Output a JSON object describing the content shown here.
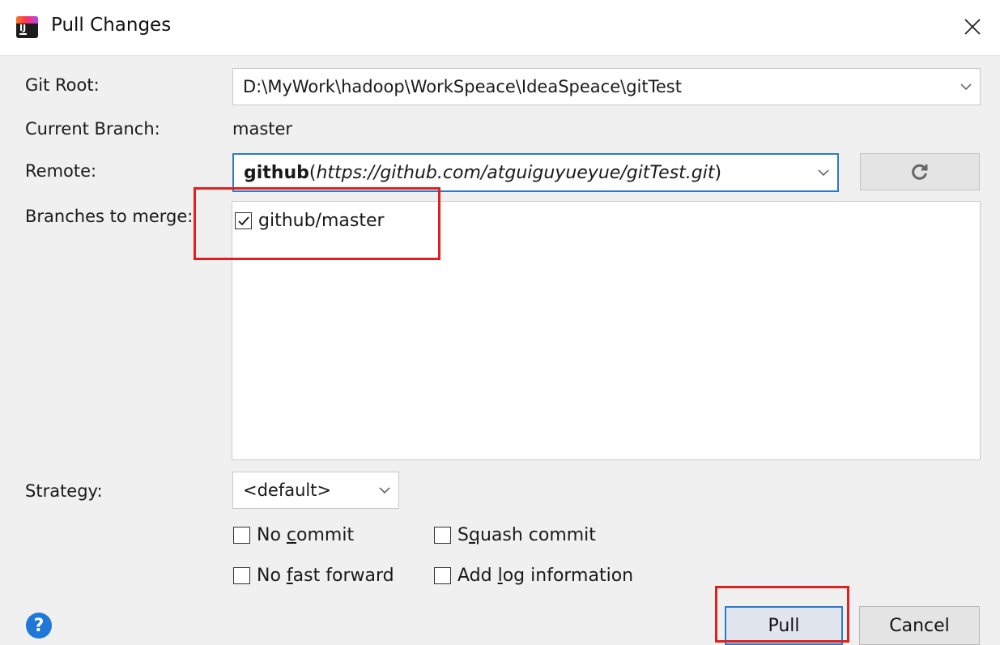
{
  "dialog": {
    "title": "Pull Changes"
  },
  "labels": {
    "git_root": "Git Root:",
    "current_branch": "Current Branch:",
    "remote": "Remote:",
    "branches": "Branches to merge:",
    "strategy": "Strategy:"
  },
  "git_root": {
    "value": "D:\\MyWork\\hadoop\\WorkSpeace\\IdeaSpeace\\gitTest"
  },
  "current_branch": {
    "value": "master"
  },
  "remote": {
    "name": "github",
    "open": "(",
    "url": "https://github.com/atguiguyueyue/gitTest.git",
    "close": ")"
  },
  "branches": [
    {
      "label": "github/master",
      "checked": true
    }
  ],
  "strategy": {
    "value": "<default>"
  },
  "options": {
    "no_commit": {
      "pre": "No ",
      "key": "c",
      "post": "ommit",
      "checked": false
    },
    "squash_commit": {
      "pre": "S",
      "key": "q",
      "post": "uash commit",
      "checked": false
    },
    "no_fast_forward": {
      "pre": "No ",
      "key": "f",
      "post": "ast forward",
      "checked": false
    },
    "add_log_information": {
      "pre": "Add ",
      "key": "l",
      "post": "og information",
      "checked": false
    }
  },
  "buttons": {
    "pull": "Pull",
    "cancel": "Cancel"
  },
  "icons": {
    "app": "intellij-idea-icon",
    "close": "close-icon",
    "refresh": "refresh-icon",
    "help": "help-icon",
    "dropdown": "chevron-down-icon"
  },
  "colors": {
    "focus_border": "#2f79c9",
    "highlight": "#e02020",
    "help": "#1f77d8"
  }
}
